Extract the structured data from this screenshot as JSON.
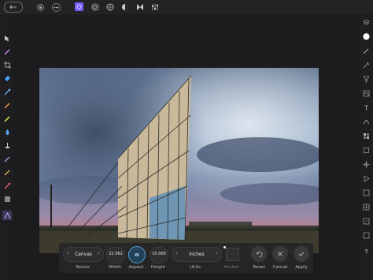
{
  "top_toolbar": {
    "back_icon": "back-arrow-icon",
    "more_icon": "more-icon",
    "persona_icons": [
      "photo-persona-icon",
      "liquify-persona-icon",
      "develop-persona-icon",
      "tone-mapping-persona-icon",
      "export-persona-icon",
      "sliders-icon"
    ]
  },
  "left_tools": [
    "move-tool-icon",
    "brush-tool-icon",
    "crop-tool-icon",
    "flood-fill-tool-icon",
    "color-picker-icon",
    "paint-brush-icon",
    "eraser-icon",
    "smudge-icon",
    "clone-icon",
    "healing-icon",
    "dodge-icon",
    "selection-icon",
    "gradient-icon"
  ],
  "right_tools": [
    "layers-icon",
    "adjustments-icon",
    "color-icon",
    "brushes-icon",
    "history-icon",
    "filter-icon",
    "stock-icon",
    "character-icon",
    "text-icon",
    "swatches-icon",
    "transform-icon",
    "navigator-icon",
    "play-icon",
    "channels-icon",
    "grid-icon",
    "info-icon"
  ],
  "resize_panel": {
    "canvas_label": "Canvas",
    "resize_label": "Resize",
    "width_value": "22.562",
    "width_label": "Width",
    "aspect_label": "Aspect",
    "height_value": "15.000",
    "height_label": "Height",
    "units_value": "Inches",
    "units_label": "Units",
    "anchor_label": "Anchor",
    "reset_label": "Reset",
    "cancel_label": "Cancel",
    "apply_label": "Apply"
  },
  "colors": {
    "background": "#1b1b1d",
    "accent": "#7b5cff",
    "panel": "#262628"
  }
}
